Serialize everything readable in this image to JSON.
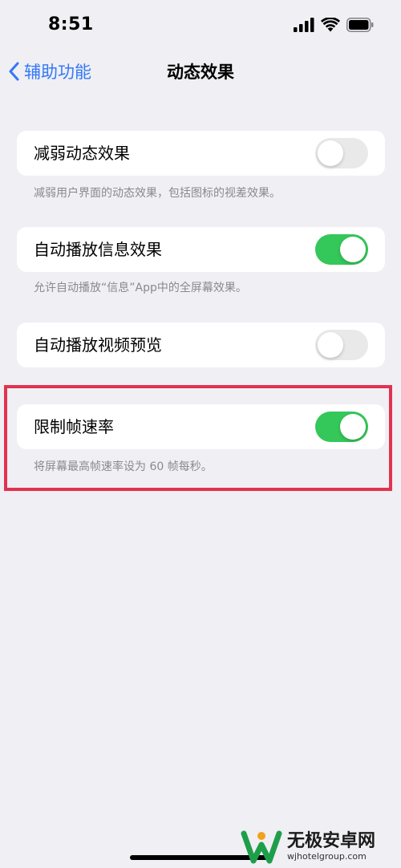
{
  "status_bar": {
    "time": "8:51"
  },
  "nav": {
    "back_label": "辅助功能",
    "title": "动态效果"
  },
  "settings": [
    {
      "label": "减弱动态效果",
      "on": false,
      "footer": "减弱用户界面的动态效果，包括图标的视差效果。"
    },
    {
      "label": "自动播放信息效果",
      "on": true,
      "footer": "允许自动播放“信息”App中的全屏幕效果。"
    },
    {
      "label": "自动播放视频预览",
      "on": false,
      "footer": ""
    },
    {
      "label": "限制帧速率",
      "on": true,
      "footer": "将屏幕最高帧速率设为 60 帧每秒。"
    }
  ],
  "colors": {
    "accent": "#3478f6",
    "toggle_on": "#34c759",
    "toggle_off": "#e9e9ea",
    "highlight": "#e0334f",
    "background": "#efeff4"
  },
  "watermark": {
    "title": "无极安卓网",
    "url": "wjhotelgroup.com"
  }
}
